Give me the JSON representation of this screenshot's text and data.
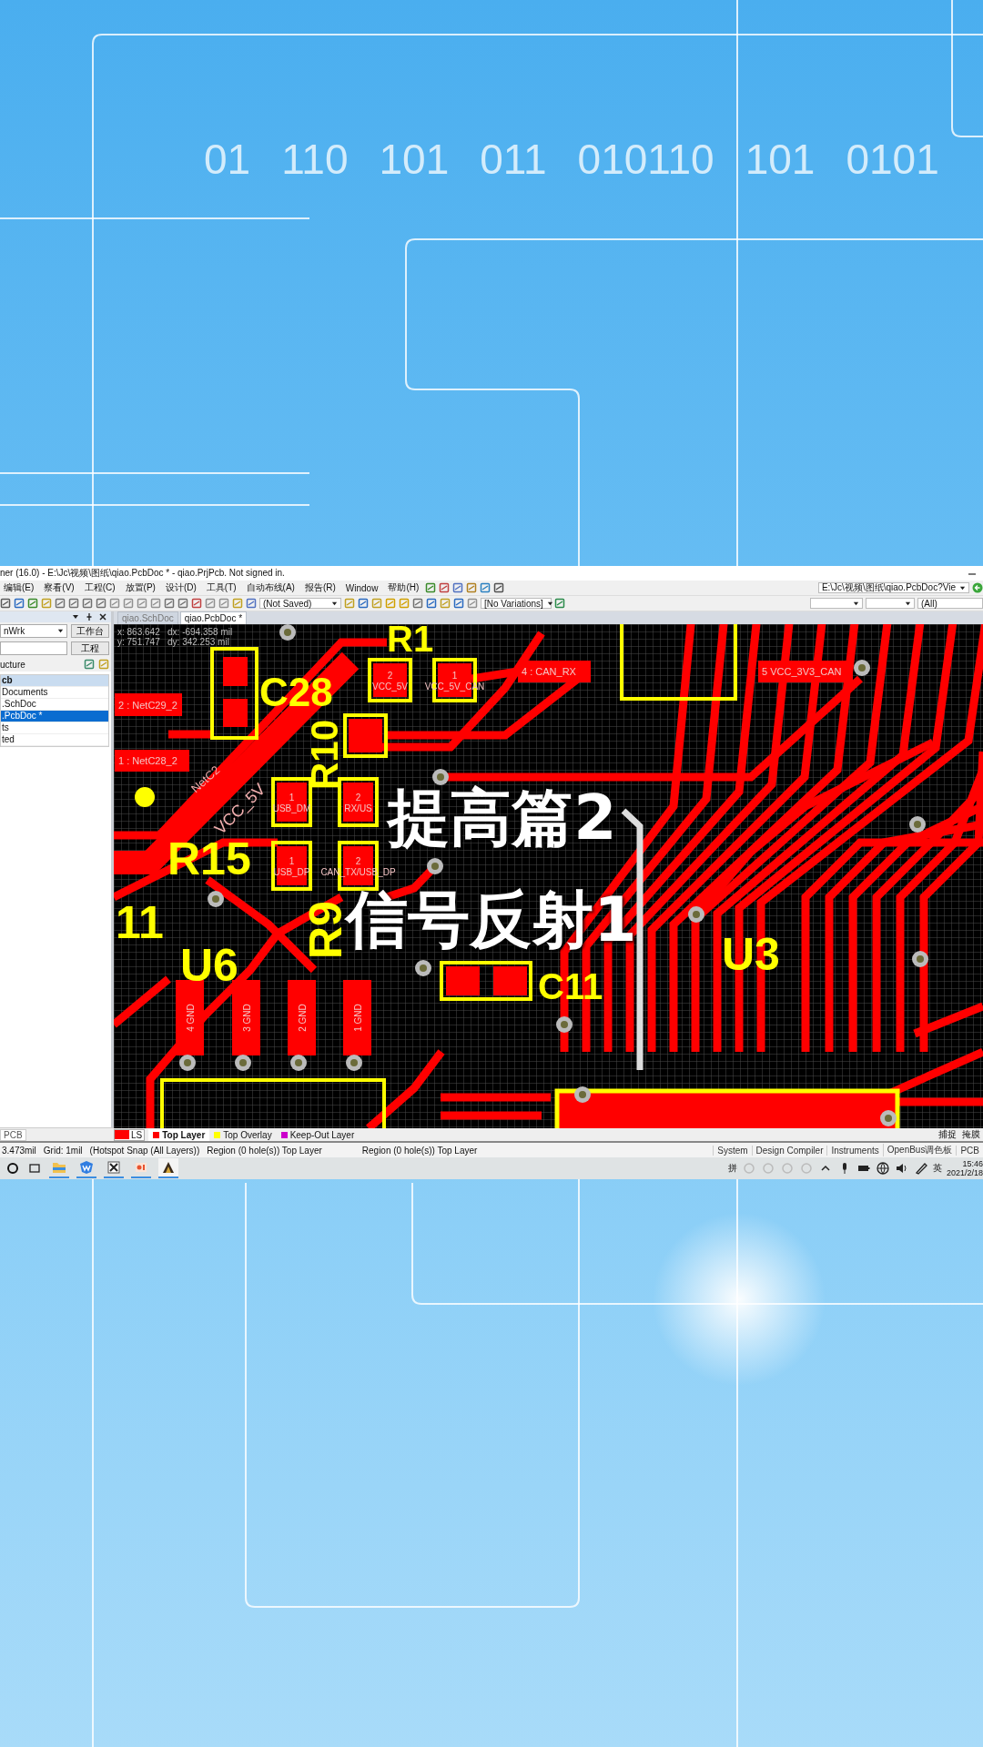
{
  "background": {
    "binary_digits": [
      "01",
      "110",
      "101",
      "011",
      "010110",
      "101",
      "0101"
    ]
  },
  "window": {
    "title": "ner (16.0) - E:\\Jc\\视频\\图纸\\qiao.PcbDoc * - qiao.PrjPcb. Not signed in.",
    "menu": [
      "编辑(E)",
      "察看(V)",
      "工程(C)",
      "放置(P)",
      "设计(D)",
      "工具(T)",
      "自动布线(A)",
      "报告(R)",
      "Window",
      "帮助(H)"
    ],
    "path_box": "E:\\Jc\\视频\\图纸\\qiao.PcbDoc?Vie",
    "toolbar": {
      "saved_state": "(Not Saved)",
      "variations": "[No Variations]",
      "filter": "(All)"
    }
  },
  "projects_panel": {
    "workspace": "nWrk",
    "buttons": [
      "工作台",
      "工程"
    ],
    "view_label": "ucture",
    "tree": [
      {
        "label": "cb",
        "kind": "project",
        "selected": false
      },
      {
        "label": "Documents",
        "kind": "file",
        "selected": false
      },
      {
        "label": ".SchDoc",
        "kind": "file",
        "selected": false
      },
      {
        "label": ".PcbDoc *",
        "kind": "file",
        "selected": true
      },
      {
        "label": "ts",
        "kind": "file",
        "selected": false
      },
      {
        "label": "ted",
        "kind": "file",
        "selected": false
      }
    ],
    "bottom_tab": "PCB"
  },
  "document_tabs": [
    {
      "label": "qiao.SchDoc",
      "selected": false
    },
    {
      "label": "qiao.PcbDoc *",
      "selected": true
    }
  ],
  "pcb": {
    "readout": [
      "x: 863.642   dx: -694.358 mil",
      "y: 751.747   dy: 342.253 mil"
    ],
    "designators": [
      "C28",
      "R10",
      "R1",
      "R15",
      "11",
      "U6",
      "R9",
      "C11",
      "U3"
    ],
    "net_labels": [
      "NetC2",
      "VCC_5V"
    ],
    "pads": [
      {
        "kind": "stacked",
        "number": "2",
        "net": "VCC_5V"
      },
      {
        "kind": "stacked",
        "number": "1",
        "net": "VCC_5V_CAN"
      },
      {
        "kind": "inline",
        "label": "4 : CAN_RX"
      },
      {
        "kind": "inline",
        "label": "5  VCC_3V3_CAN"
      },
      {
        "kind": "inline",
        "label": "2 : NetC29_2"
      },
      {
        "kind": "inline",
        "label": "1 : NetC28_2"
      },
      {
        "kind": "stacked",
        "number": "1",
        "net": "USB_DM"
      },
      {
        "kind": "stacked",
        "number": "2",
        "net": "RX/US"
      },
      {
        "kind": "stacked",
        "number": "1",
        "net": "USB_DP"
      },
      {
        "kind": "stacked",
        "number": "2",
        "net": "CAN_TX/USB_DP"
      },
      {
        "kind": "vertical",
        "number": "4",
        "net": "GND"
      },
      {
        "kind": "vertical",
        "number": "3",
        "net": "GND"
      },
      {
        "kind": "vertical",
        "number": "2",
        "net": "GND"
      },
      {
        "kind": "vertical",
        "number": "1",
        "net": "GND"
      }
    ]
  },
  "layer_bar": {
    "current": "LS",
    "layers": [
      {
        "name": "Top Layer",
        "color": "#ff0000",
        "selected": true
      },
      {
        "name": "Top Overlay",
        "color": "#ffff00",
        "selected": false
      },
      {
        "name": "Keep-Out Layer",
        "color": "#cc00cc",
        "selected": false
      }
    ],
    "right_buttons": [
      "捕捉",
      "掩膜"
    ]
  },
  "status_bar": {
    "items": [
      "3.473mil",
      "Grid: 1mil",
      "(Hotspot Snap (All Layers))",
      "Region (0 hole(s)) Top Layer"
    ],
    "second_region": "Region (0 hole(s)) Top Layer",
    "panels": [
      "System",
      "Design Compiler",
      "Instruments",
      "OpenBus调色板",
      "PCB"
    ]
  },
  "taskbar": {
    "input_method": "拼",
    "language": "英",
    "time": "15:46",
    "date": "2021/2/18"
  },
  "caption": [
    "提高篇2",
    "信号反射1"
  ]
}
